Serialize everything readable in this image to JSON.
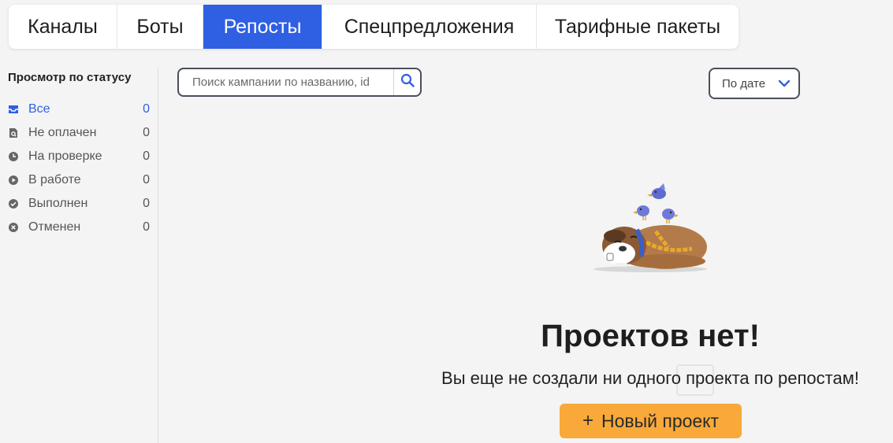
{
  "tabs": [
    {
      "label": "Каналы",
      "active": false
    },
    {
      "label": "Боты",
      "active": false
    },
    {
      "label": "Репосты",
      "active": true
    },
    {
      "label": "Спецпредложения",
      "active": false
    },
    {
      "label": "Тарифные пакеты",
      "active": false
    }
  ],
  "sidebar": {
    "title": "Просмотр по статусу",
    "items": [
      {
        "label": "Все",
        "count": "0",
        "icon": "inbox-icon",
        "active": true
      },
      {
        "label": "Не оплачен",
        "count": "0",
        "icon": "document-search-icon"
      },
      {
        "label": "На проверке",
        "count": "0",
        "icon": "clock-icon"
      },
      {
        "label": "В работе",
        "count": "0",
        "icon": "play-icon"
      },
      {
        "label": "Выполнен",
        "count": "0",
        "icon": "check-circle-icon"
      },
      {
        "label": "Отменен",
        "count": "0",
        "icon": "x-circle-icon"
      }
    ]
  },
  "search": {
    "placeholder": "Поиск кампании по названию, id",
    "icon": "search-icon"
  },
  "sort": {
    "selected": "По дате",
    "icon": "chevron-down-icon"
  },
  "empty_state": {
    "illustration": "sleeping-dog-with-birds",
    "title": "Проектов нет!",
    "subtitle": "Вы еще не создали ни одного проекта по репостам!",
    "button_plus": "+",
    "button_label": "Новый проект"
  },
  "colors": {
    "accent": "#2f5fe3",
    "button": "#f8a93a",
    "background": "#f4f4f4"
  }
}
